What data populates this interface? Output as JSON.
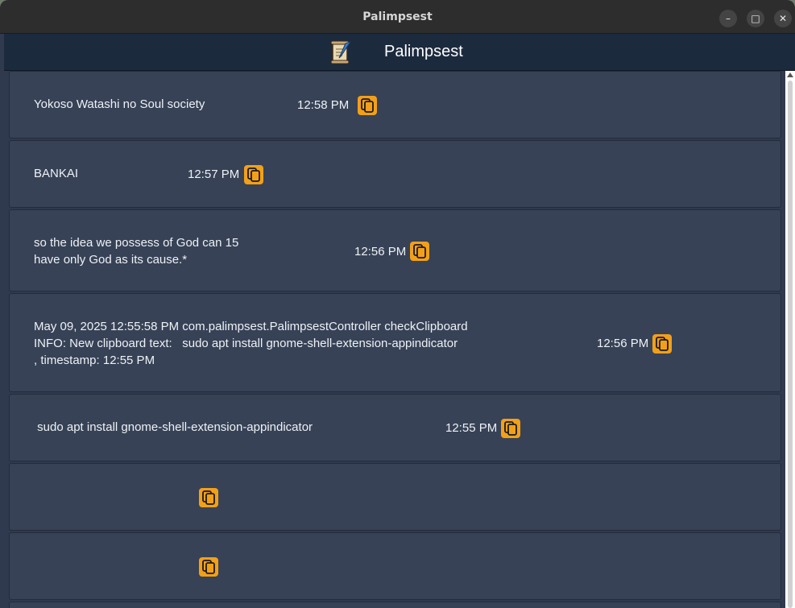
{
  "window": {
    "title": "Palimpsest",
    "minimize_label": "–",
    "maximize_label": "□",
    "close_label": "✕"
  },
  "app": {
    "title": "Palimpsest",
    "icon": "scroll-quill-icon"
  },
  "clipboard_items": [
    {
      "text": "Yokoso Watashi no Soul society",
      "time": "12:58 PM"
    },
    {
      "text": "BANKAI",
      "time": "12:57 PM"
    },
    {
      "text": "so the idea we possess of God can 15\nhave only God as its cause.*",
      "time": "12:56 PM"
    },
    {
      "text": "May 09, 2025 12:55:58 PM com.palimpsest.PalimpsestController checkClipboard\nINFO: New clipboard text:   sudo apt install gnome-shell-extension-appindicator\n, timestamp: 12:55 PM",
      "time": "12:56 PM"
    },
    {
      "text": " sudo apt install gnome-shell-extension-appindicator",
      "time": "12:55 PM"
    },
    {
      "text": "",
      "time": ""
    },
    {
      "text": "",
      "time": ""
    }
  ],
  "colors": {
    "accent": "#f2a019",
    "row_bg": "#374256",
    "header_bg": "#1c2a3e",
    "list_bg": "#2f3a4f"
  }
}
